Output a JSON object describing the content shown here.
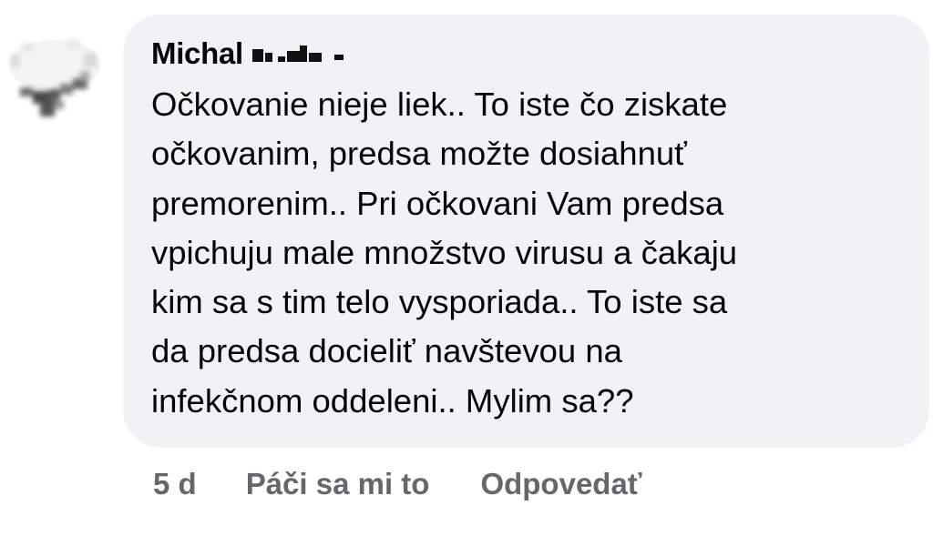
{
  "comment": {
    "author": "Michal",
    "text": "Očkovanie nieje liek.. To iste čo ziskate\nočkovanim, predsa možte dosiahnuť\npremorenim.. Pri očkovani Vam predsa\nvpichuju male množstvo virusu a čakaju\nkim sa s tim telo vysporiada.. To iste sa\nda predsa docieliť navštevou na\ninfekčnom oddeleni.. Mylim sa??"
  },
  "actions": {
    "timestamp": "5 d",
    "like_label": "Páči sa mi to",
    "reply_label": "Odpovedať"
  },
  "colors": {
    "bubble": "#f0f2f5",
    "text": "#050505",
    "secondary_text": "#65676b"
  }
}
